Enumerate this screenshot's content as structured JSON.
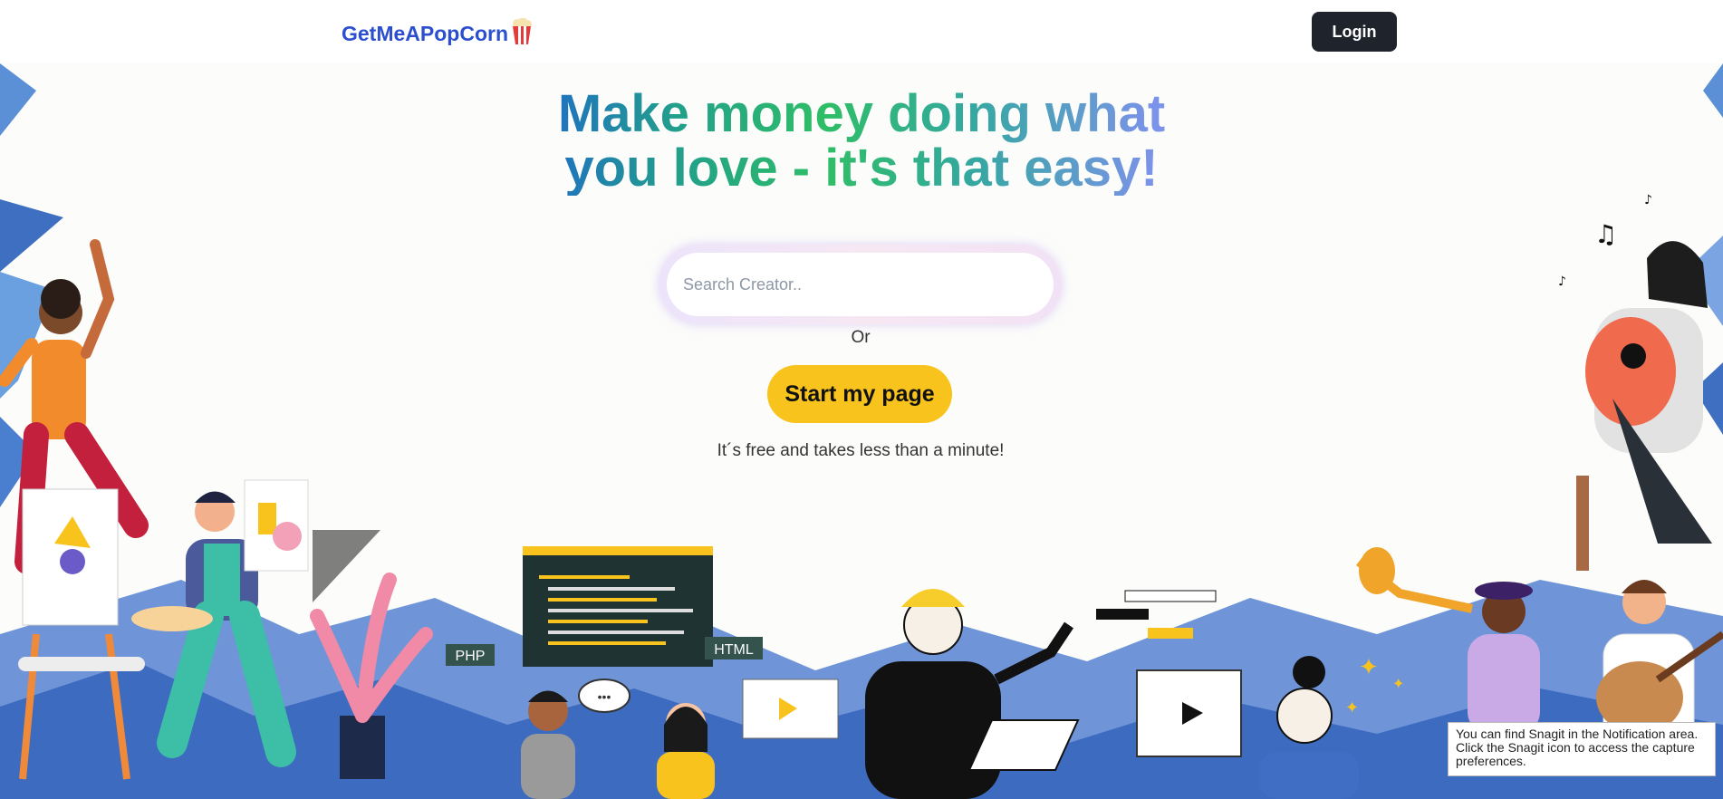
{
  "brand": {
    "name": "GetMeAPopCorn",
    "logo_icon": "popcorn-icon"
  },
  "nav": {
    "login_label": "Login"
  },
  "hero": {
    "title_line1": "Make money doing what",
    "title_line2": "you love - it's that easy!",
    "search_placeholder": "Search Creator..",
    "search_value": "",
    "or_label": "Or",
    "cta_label": "Start my page",
    "subtext": "It´s free and takes less than a minute!"
  },
  "illustration": {
    "php_tag": "PHP",
    "html_tag": "HTML",
    "speech_bubble": "•••"
  },
  "snagit": {
    "line1": "You can find Snagit in the Notification area.",
    "line2": "Click the Snagit icon to access the capture preferences."
  },
  "colors": {
    "brand": "#2b4fcf",
    "login_bg": "#1f242c",
    "cta_bg": "#f9c31d",
    "gradient_start": "#1f5fd6",
    "gradient_mid": "#2fbe66",
    "gradient_end": "#7b93e8"
  }
}
